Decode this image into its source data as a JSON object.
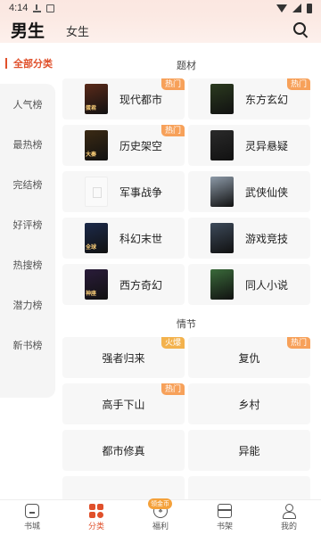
{
  "status_bar": {
    "time": "4:14"
  },
  "header": {
    "tab_male": "男生",
    "tab_female": "女生"
  },
  "sidebar": {
    "all_label": "全部分类",
    "items": [
      {
        "label": "人气榜"
      },
      {
        "label": "最热榜"
      },
      {
        "label": "完结榜"
      },
      {
        "label": "好评榜"
      },
      {
        "label": "热搜榜"
      },
      {
        "label": "潜力榜"
      },
      {
        "label": "新书榜"
      }
    ]
  },
  "themes": {
    "title": "题材",
    "items": [
      {
        "label": "现代都市",
        "badge": "热门",
        "cover": "#5a2a1a",
        "cover_text": "蛋君"
      },
      {
        "label": "东方玄幻",
        "badge": "热门",
        "cover": "#2b3a1f",
        "cover_text": ""
      },
      {
        "label": "历史架空",
        "badge": "热门",
        "cover": "#3b2a14",
        "cover_text": "大秦"
      },
      {
        "label": "灵异悬疑",
        "badge": "",
        "cover": "#2a2a2a",
        "cover_text": ""
      },
      {
        "label": "军事战争",
        "badge": "",
        "cover": "",
        "cover_text": ""
      },
      {
        "label": "武侠仙侠",
        "badge": "",
        "cover": "#8d9aa8",
        "cover_text": ""
      },
      {
        "label": "科幻末世",
        "badge": "",
        "cover": "#1c2a4a",
        "cover_text": "全球"
      },
      {
        "label": "游戏竞技",
        "badge": "",
        "cover": "#3d4a5a",
        "cover_text": ""
      },
      {
        "label": "西方奇幻",
        "badge": "",
        "cover": "#2a1c3a",
        "cover_text": "神座"
      },
      {
        "label": "同人小说",
        "badge": "",
        "cover": "#3a6a3a",
        "cover_text": ""
      }
    ]
  },
  "plots": {
    "title": "情节",
    "items": [
      {
        "label": "强者归来",
        "badge": "火爆"
      },
      {
        "label": "复仇",
        "badge": "热门"
      },
      {
        "label": "高手下山",
        "badge": "热门"
      },
      {
        "label": "乡村",
        "badge": ""
      },
      {
        "label": "都市修真",
        "badge": ""
      },
      {
        "label": "异能",
        "badge": ""
      },
      {
        "label": "",
        "badge": ""
      },
      {
        "label": "",
        "badge": ""
      }
    ]
  },
  "bottom_nav": {
    "items": [
      {
        "label": "书城",
        "icon": "home-icon"
      },
      {
        "label": "分类",
        "icon": "category-icon"
      },
      {
        "label": "福利",
        "icon": "yen-icon"
      },
      {
        "label": "书架",
        "icon": "shelf-icon"
      },
      {
        "label": "我的",
        "icon": "user-icon"
      }
    ],
    "welfare_badge": "领金币"
  },
  "colors": {
    "accent": "#e0502b",
    "badge": "#f7a15a"
  }
}
